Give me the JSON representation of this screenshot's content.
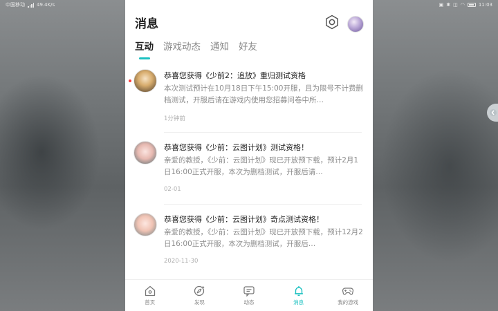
{
  "status_bar": {
    "carrier": "中国移动",
    "network_speed": "49.4K/s",
    "time": "11:03"
  },
  "header": {
    "title": "消息"
  },
  "tabs": [
    {
      "label": "互动",
      "active": true
    },
    {
      "label": "游戏动态",
      "active": false
    },
    {
      "label": "通知",
      "active": false
    },
    {
      "label": "好友",
      "active": false
    }
  ],
  "messages": [
    {
      "title": "恭喜您获得《少前2：追放》重归测试资格",
      "body": "本次测试预计在10月18日下午15:00开服，且为限号不计费删档测试，开服后请在游戏内使用您招募问卷中所…",
      "time": "1分钟前",
      "unread": true
    },
    {
      "title": "恭喜您获得《少前：云图计划》测试资格！",
      "body": "亲爱的教授，《少前：云图计划》现已开放预下载，预计2月1日16:00正式开服，本次为删档测试，开服后请…",
      "time": "02-01",
      "unread": false
    },
    {
      "title": "恭喜您获得《少前：云图计划》奇点测试资格！",
      "body": "亲爱的教授，《少前：云图计划》现已开放预下载，预计12月2日16:00正式开服，本次为删档测试，开服后…",
      "time": "2020-11-30",
      "unread": false
    }
  ],
  "bottom_nav": [
    {
      "label": "首页",
      "icon": "home-icon"
    },
    {
      "label": "发现",
      "icon": "compass-icon"
    },
    {
      "label": "动态",
      "icon": "chat-icon"
    },
    {
      "label": "消息",
      "icon": "bell-icon",
      "active": true
    },
    {
      "label": "我的游戏",
      "icon": "gamepad-icon"
    }
  ],
  "colors": {
    "accent": "#1cc1c1",
    "unread_dot": "#ff3b3b"
  }
}
